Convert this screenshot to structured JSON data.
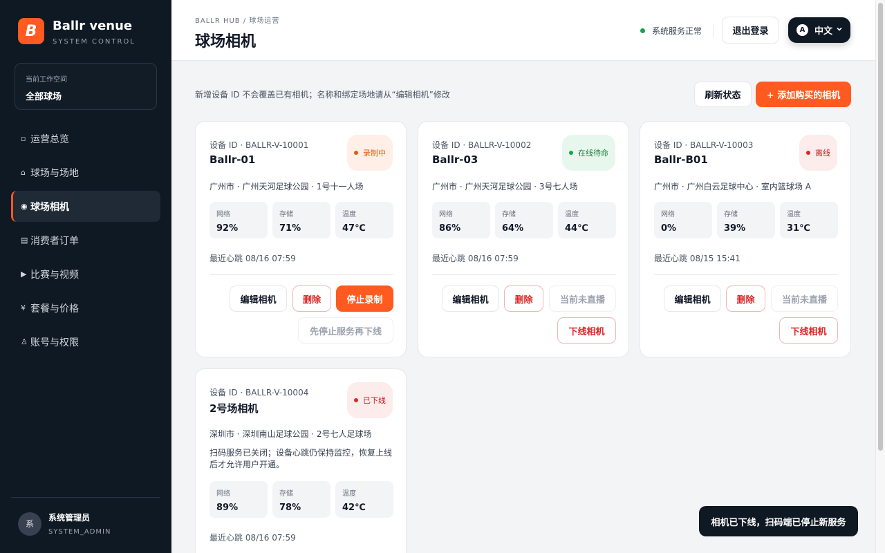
{
  "brand": {
    "logo_letter": "B",
    "name": "Ballr venue",
    "subtitle": "SYSTEM CONTROL",
    "accent_color": "#ff5a1f"
  },
  "workspace": {
    "label": "当前工作空间",
    "value": "全部球场"
  },
  "nav": [
    {
      "icon": "▫",
      "icon_name": "grid-icon",
      "label": "运营总览",
      "active": false
    },
    {
      "icon": "⌂",
      "icon_name": "home-icon",
      "label": "球场与场地",
      "active": false
    },
    {
      "icon": "◉",
      "icon_name": "camera-icon",
      "label": "球场相机",
      "active": true
    },
    {
      "icon": "▤",
      "icon_name": "receipt-icon",
      "label": "消费者订单",
      "active": false
    },
    {
      "icon": "▶",
      "icon_name": "play-icon",
      "label": "比赛与视频",
      "active": false
    },
    {
      "icon": "¥",
      "icon_name": "yen-icon",
      "label": "套餐与价格",
      "active": false
    },
    {
      "icon": "♙",
      "icon_name": "user-icon",
      "label": "账号与权限",
      "active": false
    }
  ],
  "user": {
    "avatar": "系",
    "name": "系统管理员",
    "role": "SYSTEM_ADMIN"
  },
  "header": {
    "breadcrumb": "BALLR HUB / 球场运营",
    "title": "球场相机",
    "status": "系统服务正常",
    "logout": "退出登录",
    "lang_icon": "A",
    "lang": "中文"
  },
  "toolbar": {
    "hint": "新增设备 ID 不会覆盖已有相机；名称和绑定场地请从“编辑相机”修改",
    "refresh": "刷新状态",
    "add": "+ 添加购买的相机"
  },
  "cameras": [
    {
      "device_id": "设备 ID · BALLR-V-10001",
      "name": "Ballr-01",
      "status": "录制中",
      "status_type": "recording",
      "location": "广州市 · 广州天河足球公园 · 1号十一人场",
      "metrics": [
        {
          "label": "网络",
          "value": "92%"
        },
        {
          "label": "存储",
          "value": "71%"
        },
        {
          "label": "温度",
          "value": "47℃"
        }
      ],
      "heartbeat": "最近心跳 08/16 07:59",
      "buttons": {
        "edit": "编辑相机",
        "delete": "删除",
        "primary": "停止录制",
        "secondary": "先停止服务再下线"
      }
    },
    {
      "device_id": "设备 ID · BALLR-V-10002",
      "name": "Ballr-03",
      "status": "在线待命",
      "status_type": "online",
      "location": "广州市 · 广州天河足球公园 · 3号七人场",
      "metrics": [
        {
          "label": "网络",
          "value": "86%"
        },
        {
          "label": "存储",
          "value": "64%"
        },
        {
          "label": "温度",
          "value": "44℃"
        }
      ],
      "heartbeat": "最近心跳 08/16 07:59",
      "buttons": {
        "edit": "编辑相机",
        "delete": "删除",
        "primary": "当前未直播",
        "secondary": "下线相机"
      }
    },
    {
      "device_id": "设备 ID · BALLR-V-10003",
      "name": "Ballr-B01",
      "status": "离线",
      "status_type": "offline",
      "location": "广州市 · 广州白云足球中心 · 室内篮球场 A",
      "metrics": [
        {
          "label": "网络",
          "value": "0%"
        },
        {
          "label": "存储",
          "value": "39%"
        },
        {
          "label": "温度",
          "value": "31℃"
        }
      ],
      "heartbeat": "最近心跳 08/15 15:41",
      "buttons": {
        "edit": "编辑相机",
        "delete": "删除",
        "primary": "当前未直播",
        "secondary": "下线相机"
      }
    },
    {
      "device_id": "设备 ID · BALLR-V-10004",
      "name": "2号场相机",
      "status": "已下线",
      "status_type": "offline",
      "location": "深圳市 · 深圳南山足球公园 · 2号七人足球场",
      "note": "扫码服务已关闭；设备心跳仍保持监控，恢复上线后才允许用户开通。",
      "metrics": [
        {
          "label": "网络",
          "value": "89%"
        },
        {
          "label": "存储",
          "value": "78%"
        },
        {
          "label": "温度",
          "value": "42℃"
        }
      ],
      "heartbeat": "最近心跳 08/16 07:59"
    }
  ],
  "toast": "相机已下线，扫码端已停止新服务",
  "colors": {
    "recording": "#ea580c",
    "online": "#16a34a",
    "offline": "#dc2626",
    "sidebar_bg": "#0f1923"
  }
}
